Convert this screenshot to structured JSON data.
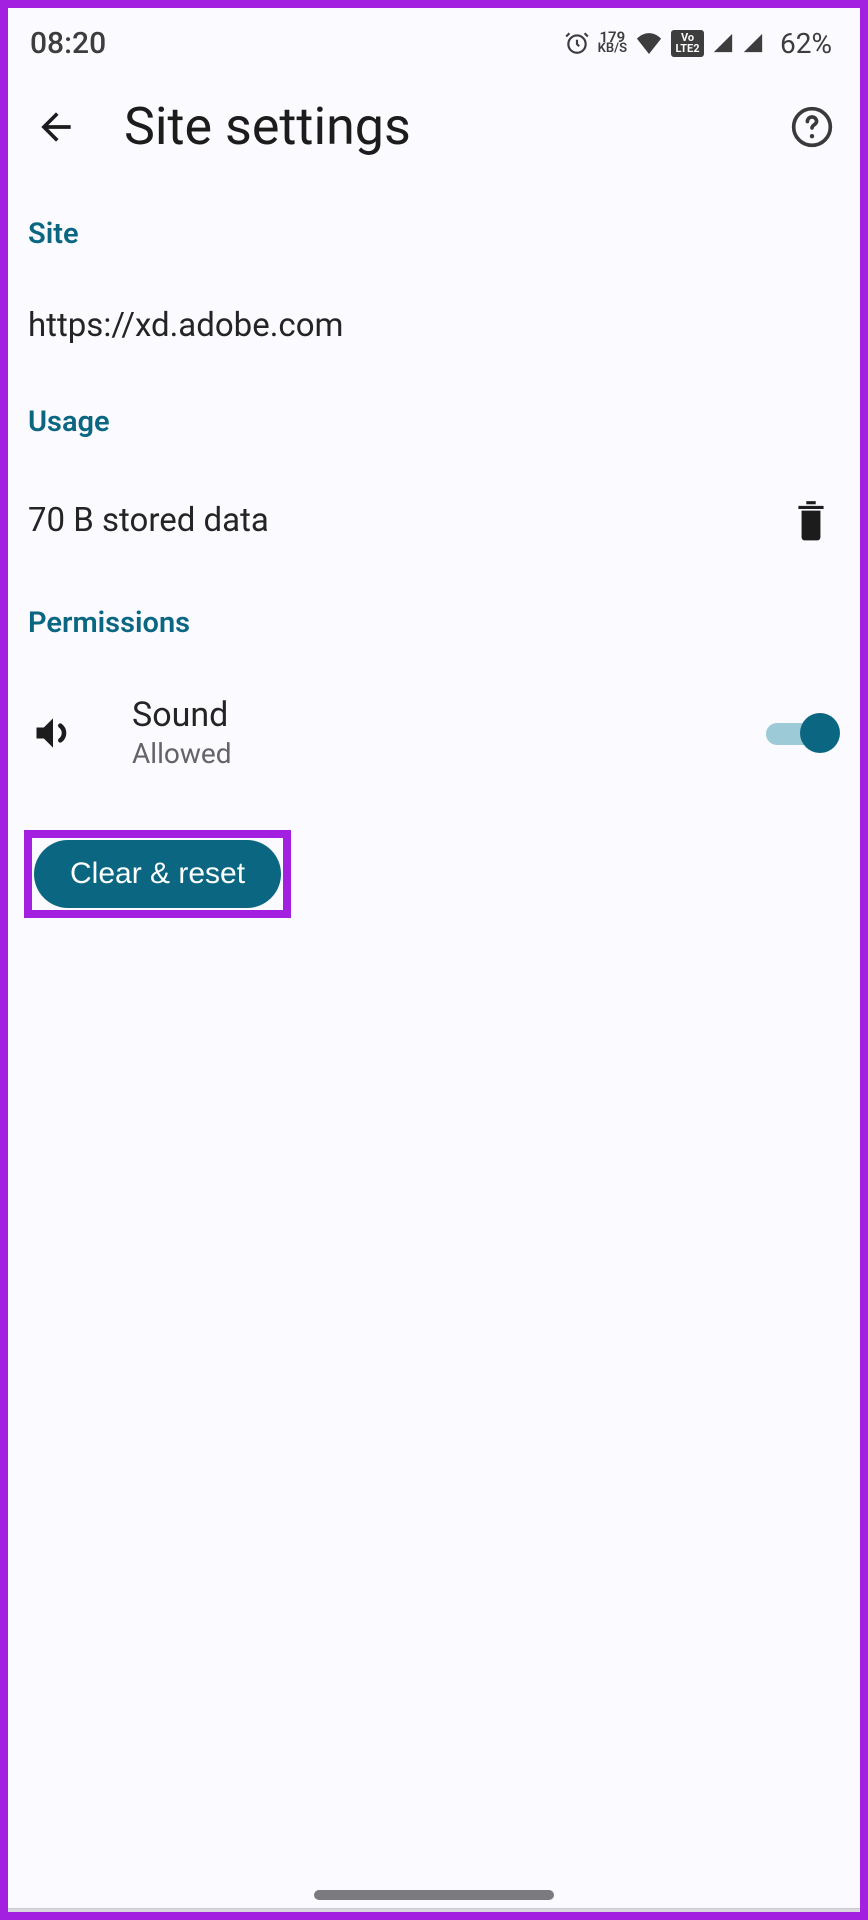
{
  "status": {
    "time": "08:20",
    "net_num": "179",
    "net_unit": "KB/S",
    "volte_top": "Vo",
    "volte_bottom": "LTE2",
    "battery": "62%"
  },
  "header": {
    "title": "Site settings"
  },
  "site": {
    "label": "Site",
    "url": "https://xd.adobe.com"
  },
  "usage": {
    "label": "Usage",
    "value": "70 B stored data"
  },
  "permissions": {
    "label": "Permissions",
    "items": [
      {
        "title": "Sound",
        "status": "Allowed",
        "enabled": true
      }
    ]
  },
  "actions": {
    "clear_reset": "Clear & reset"
  },
  "colors": {
    "accent": "#0b6781",
    "highlight": "#a320e0"
  }
}
